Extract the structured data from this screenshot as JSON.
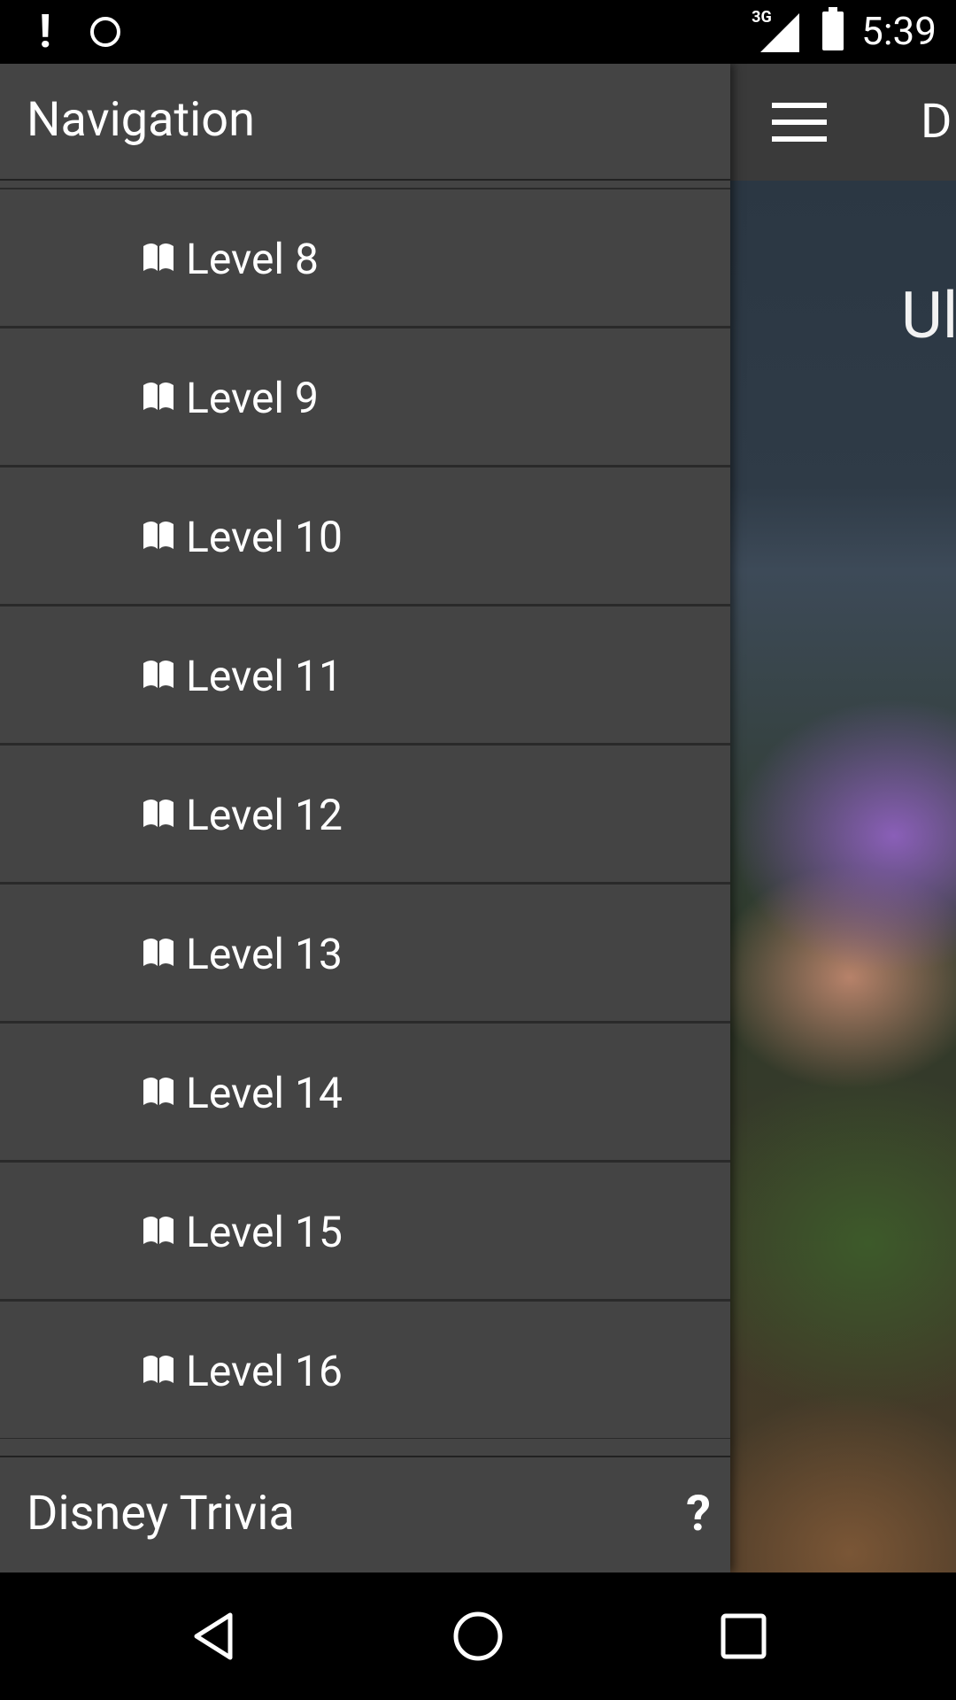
{
  "status_bar": {
    "time": "5:39",
    "network_label": "3G"
  },
  "app": {
    "toolbar_title_peek": "D",
    "hero_text_peek": "Ul"
  },
  "drawer": {
    "title": "Navigation",
    "items": [
      {
        "label": "Level 8"
      },
      {
        "label": "Level 9"
      },
      {
        "label": "Level 10"
      },
      {
        "label": "Level 11"
      },
      {
        "label": "Level 12"
      },
      {
        "label": "Level 13"
      },
      {
        "label": "Level 14"
      },
      {
        "label": "Level 15"
      },
      {
        "label": "Level 16"
      }
    ],
    "footer_title": "Disney Trivia",
    "footer_icon_text": "?"
  },
  "icons": {
    "item_icon": "book-icon",
    "help_icon": "help-icon",
    "menu_icon": "hamburger-icon"
  }
}
